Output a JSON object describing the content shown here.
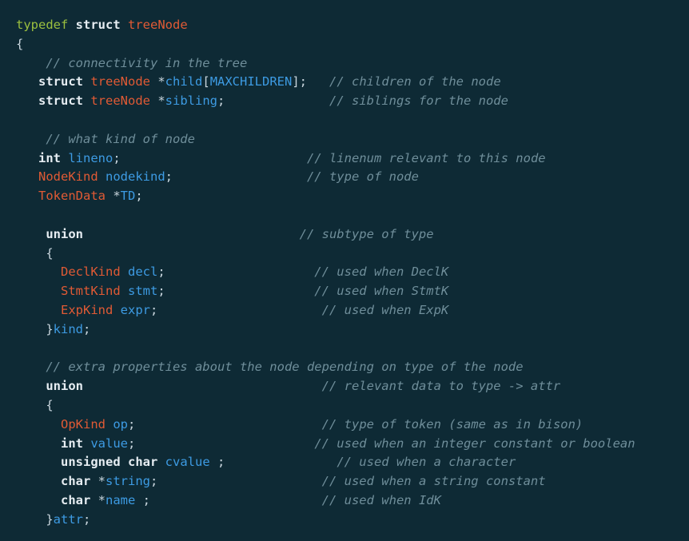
{
  "code_lines": [
    [
      {
        "t": "typedef",
        "c": "kwg",
        "n": "keyword-typedef"
      },
      {
        "t": " ",
        "c": "pun"
      },
      {
        "t": "struct",
        "c": "kw",
        "n": "keyword-struct"
      },
      {
        "t": " ",
        "c": "pun"
      },
      {
        "t": "treeNode",
        "c": "typ",
        "n": "type-name"
      }
    ],
    [
      {
        "t": "{",
        "c": "pun",
        "n": "brace-open"
      }
    ],
    [
      {
        "t": "    ",
        "c": "pun"
      },
      {
        "t": "// connectivity in the tree",
        "c": "cmt",
        "n": "comment"
      }
    ],
    [
      {
        "t": "   ",
        "c": "pun"
      },
      {
        "t": "struct",
        "c": "kw",
        "n": "keyword-struct"
      },
      {
        "t": " ",
        "c": "pun"
      },
      {
        "t": "treeNode",
        "c": "typ",
        "n": "type-name"
      },
      {
        "t": " *",
        "c": "pun"
      },
      {
        "t": "child",
        "c": "id",
        "n": "field-name"
      },
      {
        "t": "[",
        "c": "pun"
      },
      {
        "t": "MAXCHILDREN",
        "c": "id",
        "n": "macro-name"
      },
      {
        "t": "];   ",
        "c": "pun"
      },
      {
        "t": "// children of the node",
        "c": "cmt",
        "n": "comment"
      }
    ],
    [
      {
        "t": "   ",
        "c": "pun"
      },
      {
        "t": "struct",
        "c": "kw",
        "n": "keyword-struct"
      },
      {
        "t": " ",
        "c": "pun"
      },
      {
        "t": "treeNode",
        "c": "typ",
        "n": "type-name"
      },
      {
        "t": " *",
        "c": "pun"
      },
      {
        "t": "sibling",
        "c": "id",
        "n": "field-name"
      },
      {
        "t": ";              ",
        "c": "pun"
      },
      {
        "t": "// siblings for the node",
        "c": "cmt",
        "n": "comment"
      }
    ],
    [
      {
        "t": "",
        "c": "pun"
      }
    ],
    [
      {
        "t": "    ",
        "c": "pun"
      },
      {
        "t": "// what kind of node",
        "c": "cmt",
        "n": "comment"
      }
    ],
    [
      {
        "t": "   ",
        "c": "pun"
      },
      {
        "t": "int",
        "c": "kw",
        "n": "keyword-int"
      },
      {
        "t": " ",
        "c": "pun"
      },
      {
        "t": "lineno",
        "c": "id",
        "n": "field-name"
      },
      {
        "t": ";                         ",
        "c": "pun"
      },
      {
        "t": "// linenum relevant to this node",
        "c": "cmt",
        "n": "comment"
      }
    ],
    [
      {
        "t": "   ",
        "c": "pun"
      },
      {
        "t": "NodeKind",
        "c": "typ",
        "n": "type-name"
      },
      {
        "t": " ",
        "c": "pun"
      },
      {
        "t": "nodekind",
        "c": "id",
        "n": "field-name"
      },
      {
        "t": ";                  ",
        "c": "pun"
      },
      {
        "t": "// type of node",
        "c": "cmt",
        "n": "comment"
      }
    ],
    [
      {
        "t": "   ",
        "c": "pun"
      },
      {
        "t": "TokenData",
        "c": "typ",
        "n": "type-name"
      },
      {
        "t": " *",
        "c": "pun"
      },
      {
        "t": "TD",
        "c": "id",
        "n": "field-name"
      },
      {
        "t": ";",
        "c": "pun"
      }
    ],
    [
      {
        "t": "",
        "c": "pun"
      }
    ],
    [
      {
        "t": "    ",
        "c": "pun"
      },
      {
        "t": "union",
        "c": "kw",
        "n": "keyword-union"
      },
      {
        "t": "                             ",
        "c": "pun"
      },
      {
        "t": "// subtype of type",
        "c": "cmt",
        "n": "comment"
      }
    ],
    [
      {
        "t": "    ",
        "c": "pun"
      },
      {
        "t": "{",
        "c": "pun",
        "n": "brace-open"
      }
    ],
    [
      {
        "t": "      ",
        "c": "pun"
      },
      {
        "t": "DeclKind",
        "c": "typ",
        "n": "type-name"
      },
      {
        "t": " ",
        "c": "pun"
      },
      {
        "t": "decl",
        "c": "id",
        "n": "field-name"
      },
      {
        "t": ";                    ",
        "c": "pun"
      },
      {
        "t": "// used when DeclK",
        "c": "cmt",
        "n": "comment"
      }
    ],
    [
      {
        "t": "      ",
        "c": "pun"
      },
      {
        "t": "StmtKind",
        "c": "typ",
        "n": "type-name"
      },
      {
        "t": " ",
        "c": "pun"
      },
      {
        "t": "stmt",
        "c": "id",
        "n": "field-name"
      },
      {
        "t": ";                    ",
        "c": "pun"
      },
      {
        "t": "// used when StmtK",
        "c": "cmt",
        "n": "comment"
      }
    ],
    [
      {
        "t": "      ",
        "c": "pun"
      },
      {
        "t": "ExpKind",
        "c": "typ",
        "n": "type-name"
      },
      {
        "t": " ",
        "c": "pun"
      },
      {
        "t": "expr",
        "c": "id",
        "n": "field-name"
      },
      {
        "t": ";                      ",
        "c": "pun"
      },
      {
        "t": "// used when ExpK",
        "c": "cmt",
        "n": "comment"
      }
    ],
    [
      {
        "t": "    ",
        "c": "pun"
      },
      {
        "t": "}",
        "c": "pun",
        "n": "brace-close"
      },
      {
        "t": "kind",
        "c": "id",
        "n": "field-name"
      },
      {
        "t": ";",
        "c": "pun"
      }
    ],
    [
      {
        "t": "",
        "c": "pun"
      }
    ],
    [
      {
        "t": "    ",
        "c": "pun"
      },
      {
        "t": "// extra properties about the node depending on type of the node",
        "c": "cmt",
        "n": "comment"
      }
    ],
    [
      {
        "t": "    ",
        "c": "pun"
      },
      {
        "t": "union",
        "c": "kw",
        "n": "keyword-union"
      },
      {
        "t": "                                ",
        "c": "pun"
      },
      {
        "t": "// relevant data to type -> attr",
        "c": "cmt",
        "n": "comment"
      }
    ],
    [
      {
        "t": "    ",
        "c": "pun"
      },
      {
        "t": "{",
        "c": "pun",
        "n": "brace-open"
      }
    ],
    [
      {
        "t": "      ",
        "c": "pun"
      },
      {
        "t": "OpKind",
        "c": "typ",
        "n": "type-name"
      },
      {
        "t": " ",
        "c": "pun"
      },
      {
        "t": "op",
        "c": "id",
        "n": "field-name"
      },
      {
        "t": ";                         ",
        "c": "pun"
      },
      {
        "t": "// type of token (same as in bison)",
        "c": "cmt",
        "n": "comment"
      }
    ],
    [
      {
        "t": "      ",
        "c": "pun"
      },
      {
        "t": "int",
        "c": "kw",
        "n": "keyword-int"
      },
      {
        "t": " ",
        "c": "pun"
      },
      {
        "t": "value",
        "c": "id",
        "n": "field-name"
      },
      {
        "t": ";                        ",
        "c": "pun"
      },
      {
        "t": "// used when an integer constant or boolean",
        "c": "cmt",
        "n": "comment"
      }
    ],
    [
      {
        "t": "      ",
        "c": "pun"
      },
      {
        "t": "unsigned char",
        "c": "kw",
        "n": "keyword-unsigned-char"
      },
      {
        "t": " ",
        "c": "pun"
      },
      {
        "t": "cvalue",
        "c": "id",
        "n": "field-name"
      },
      {
        "t": " ;               ",
        "c": "pun"
      },
      {
        "t": "// used when a character",
        "c": "cmt",
        "n": "comment"
      }
    ],
    [
      {
        "t": "      ",
        "c": "pun"
      },
      {
        "t": "char",
        "c": "kw",
        "n": "keyword-char"
      },
      {
        "t": " *",
        "c": "pun"
      },
      {
        "t": "string",
        "c": "id",
        "n": "field-name"
      },
      {
        "t": ";                      ",
        "c": "pun"
      },
      {
        "t": "// used when a string constant",
        "c": "cmt",
        "n": "comment"
      }
    ],
    [
      {
        "t": "      ",
        "c": "pun"
      },
      {
        "t": "char",
        "c": "kw",
        "n": "keyword-char"
      },
      {
        "t": " *",
        "c": "pun"
      },
      {
        "t": "name",
        "c": "id",
        "n": "field-name"
      },
      {
        "t": " ;                       ",
        "c": "pun"
      },
      {
        "t": "// used when IdK",
        "c": "cmt",
        "n": "comment"
      }
    ],
    [
      {
        "t": "    ",
        "c": "pun"
      },
      {
        "t": "}",
        "c": "pun",
        "n": "brace-close"
      },
      {
        "t": "attr",
        "c": "id",
        "n": "field-name"
      },
      {
        "t": ";",
        "c": "pun"
      }
    ]
  ]
}
